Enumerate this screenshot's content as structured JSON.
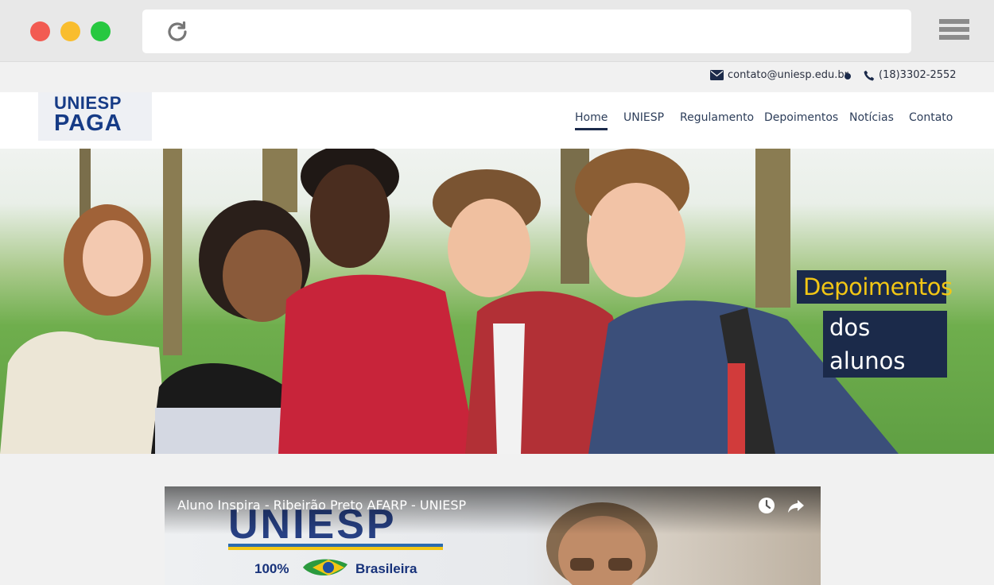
{
  "browser": {
    "icons": {
      "reload": "reload-icon",
      "menu": "hamburger-menu-icon"
    },
    "colors": {
      "close": "#f25b52",
      "minimize": "#f9bd2e",
      "maximize": "#27c840"
    }
  },
  "topbar": {
    "email": "contato@uniesp.edu.br",
    "phone": "(18)3302-2552"
  },
  "header": {
    "logo_line1": "UNIESP",
    "logo_line2": "PAGA",
    "nav": [
      "Home",
      "UNIESP",
      "Regulamento",
      "Depoimentos",
      "Notícias",
      "Contato"
    ],
    "active_nav": "Home"
  },
  "hero": {
    "line1": "Depoimentos",
    "line2": "dos alunos"
  },
  "video": {
    "title": "Aluno Inspira - Ribeirão Preto AFARP - UNIESP",
    "brand": "UNIESP",
    "tag_left": "100%",
    "tag_right": "Brasileira",
    "icons": {
      "watch_later": "clock-icon",
      "share": "share-icon"
    }
  },
  "colors": {
    "navy": "#1b2a4a",
    "accent_yellow": "#f2c615",
    "logo_blue": "#163b86"
  }
}
